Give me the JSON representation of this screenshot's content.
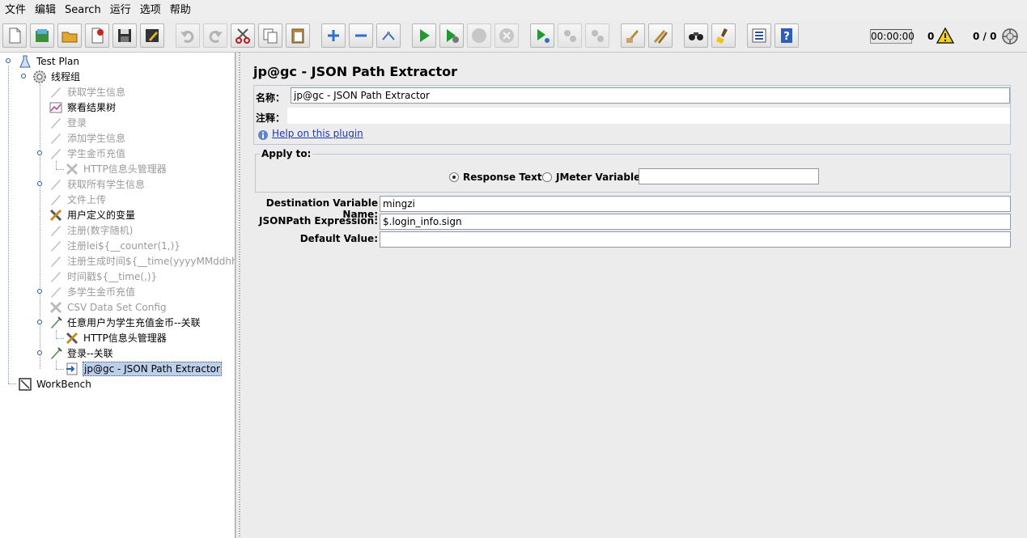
{
  "menu": [
    "文件",
    "编辑",
    "Search",
    "运行",
    "选项",
    "帮助"
  ],
  "toolbar": {
    "timer": "00:00:00",
    "error_count": "0",
    "thread_count": "0 / 0",
    "buttons": [
      "new-icon",
      "templates-icon",
      "open-icon",
      "close-icon",
      "save-icon",
      "save-as-icon",
      "undo-icon",
      "redo-icon",
      "cut-icon",
      "copy-icon",
      "paste-icon",
      "expand-icon",
      "collapse-icon",
      "toggle-icon",
      "start-icon",
      "start-no-pause-icon",
      "stop-icon",
      "shutdown-icon",
      "remote-start-icon",
      "remote-stop-icon",
      "remote-shutdown-icon",
      "clear-icon",
      "clear-all-icon",
      "search-icon",
      "reset-search-icon",
      "function-helper-icon",
      "help-icon"
    ]
  },
  "tree": [
    {
      "label": "Test Plan",
      "icon": "test-plan-icon",
      "state": "normal"
    },
    {
      "label": "线程组",
      "icon": "gear-icon",
      "state": "normal"
    },
    {
      "label": "获取学生信息",
      "icon": "sampler-icon",
      "state": "disabled"
    },
    {
      "label": "察看结果树",
      "icon": "listener-icon",
      "state": "normal"
    },
    {
      "label": "登录",
      "icon": "sampler-icon",
      "state": "disabled"
    },
    {
      "label": "添加学生信息",
      "icon": "sampler-icon",
      "state": "disabled"
    },
    {
      "label": "学生金币充值",
      "icon": "sampler-icon",
      "state": "disabled"
    },
    {
      "label": "HTTP信息头管理器",
      "icon": "config-icon",
      "state": "disabled"
    },
    {
      "label": "获取所有学生信息",
      "icon": "sampler-icon",
      "state": "disabled"
    },
    {
      "label": "文件上传",
      "icon": "sampler-icon",
      "state": "disabled"
    },
    {
      "label": "用户定义的变量",
      "icon": "config-icon",
      "state": "normal"
    },
    {
      "label": "注册(数字随机)",
      "icon": "sampler-icon",
      "state": "disabled"
    },
    {
      "label": "注册lei${__counter(1,)}",
      "icon": "sampler-icon",
      "state": "disabled"
    },
    {
      "label": "注册生成时间${__time(yyyyMMddhhmm",
      "icon": "sampler-icon",
      "state": "disabled"
    },
    {
      "label": "时间戳${__time(,)}",
      "icon": "sampler-icon",
      "state": "disabled"
    },
    {
      "label": "多学生金币充值",
      "icon": "sampler-icon",
      "state": "disabled"
    },
    {
      "label": "CSV Data Set Config",
      "icon": "config-icon",
      "state": "disabled"
    },
    {
      "label": "任意用户为学生充值金币--关联",
      "icon": "sampler-icon",
      "state": "normal"
    },
    {
      "label": "HTTP信息头管理器",
      "icon": "config-icon",
      "state": "normal"
    },
    {
      "label": "登录--关联",
      "icon": "sampler-icon",
      "state": "normal"
    },
    {
      "label": "jp@gc - JSON Path Extractor",
      "icon": "extractor-icon",
      "state": "selected"
    },
    {
      "label": "WorkBench",
      "icon": "workbench-icon",
      "state": "normal"
    }
  ],
  "panel": {
    "title": "jp@gc - JSON Path Extractor",
    "name_label": "名称：",
    "name_value": "jp@gc - JSON Path Extractor",
    "comment_label": "注释：",
    "comment_value": "",
    "help_link": "Help on this plugin",
    "apply_to_title": "Apply to:",
    "radio_response_text": "Response Text",
    "radio_jmeter_variable": "JMeter Variable:",
    "jmeter_variable_value": "",
    "dest_var_label": "Destination Variable Name:",
    "dest_var_value": "mingzi",
    "jsonpath_label": "JSONPath Expression:",
    "jsonpath_value": "$.login_info.sign",
    "default_label": "Default Value:",
    "default_value": ""
  }
}
